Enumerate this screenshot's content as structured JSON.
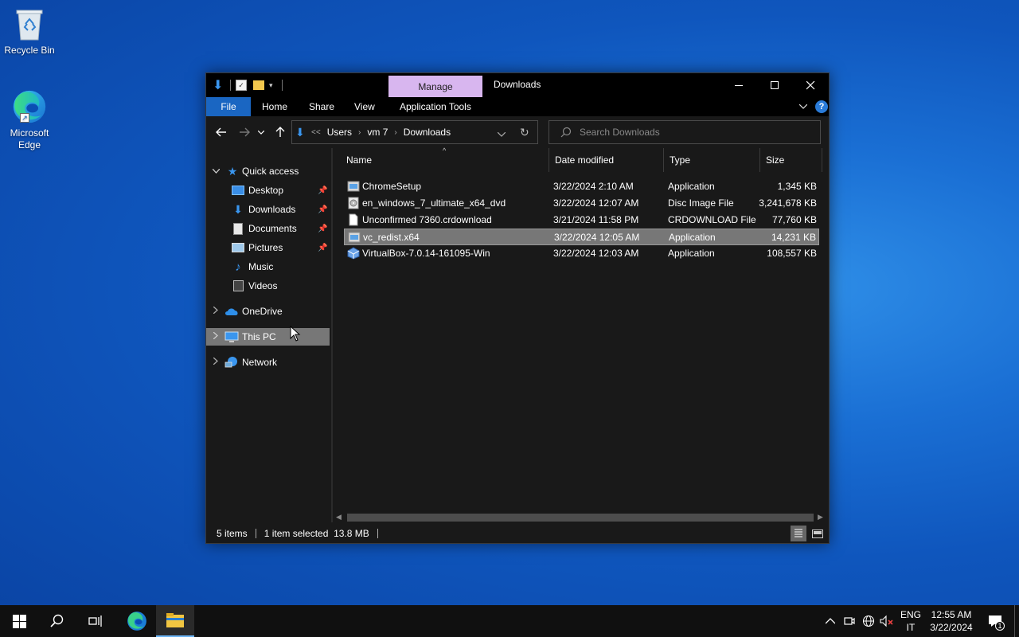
{
  "desktop": {
    "icons": [
      {
        "label": "Recycle Bin"
      },
      {
        "label": "Microsoft Edge"
      }
    ]
  },
  "window": {
    "title": "Downloads",
    "manage_tab": "Manage",
    "ribbon_tabs": [
      "File",
      "Home",
      "Share",
      "View",
      "Application Tools"
    ],
    "address": {
      "overflow": "<<",
      "crumbs": [
        "Users",
        "vm 7",
        "Downloads"
      ]
    },
    "search": {
      "placeholder": "Search Downloads"
    },
    "nav": {
      "quick_access": "Quick access",
      "items": [
        "Desktop",
        "Downloads",
        "Documents",
        "Pictures",
        "Music",
        "Videos"
      ],
      "onedrive": "OneDrive",
      "this_pc": "This PC",
      "network": "Network"
    },
    "columns": {
      "name": "Name",
      "date": "Date modified",
      "type": "Type",
      "size": "Size"
    },
    "files": [
      {
        "name": "ChromeSetup",
        "date": "3/22/2024 2:10 AM",
        "type": "Application",
        "size": "1,345 KB",
        "icon": "installer-icon"
      },
      {
        "name": "en_windows_7_ultimate_x64_dvd",
        "date": "3/22/2024 12:07 AM",
        "type": "Disc Image File",
        "size": "3,241,678 KB",
        "icon": "disc-image-icon"
      },
      {
        "name": "Unconfirmed 7360.crdownload",
        "date": "3/21/2024 11:58 PM",
        "type": "CRDOWNLOAD File",
        "size": "77,760 KB",
        "icon": "blank-file-icon"
      },
      {
        "name": "vc_redist.x64",
        "date": "3/22/2024 12:05 AM",
        "type": "Application",
        "size": "14,231 KB",
        "icon": "installer-icon",
        "selected": true
      },
      {
        "name": "VirtualBox-7.0.14-161095-Win",
        "date": "3/22/2024 12:03 AM",
        "type": "Application",
        "size": "108,557 KB",
        "icon": "virtualbox-icon"
      }
    ],
    "status": {
      "items": "5 items",
      "selected": "1 item selected  13.8 MB"
    }
  },
  "taskbar": {
    "lang": {
      "top": "ENG",
      "bottom": "IT"
    },
    "clock": {
      "time": "12:55 AM",
      "date": "3/22/2024"
    },
    "notifications": "1"
  }
}
